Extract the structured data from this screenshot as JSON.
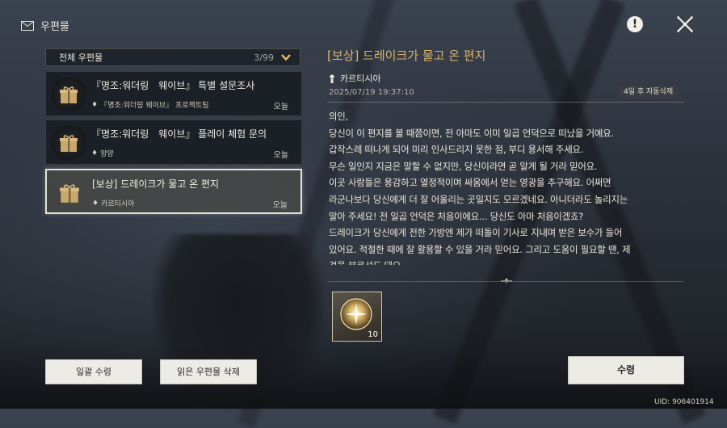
{
  "header": {
    "title": "우편물",
    "mail_icon": "mail-icon",
    "alert_icon": "exclamation-icon",
    "close_icon": "close-icon"
  },
  "list": {
    "header_label": "전체 우편물",
    "count": "3/99",
    "items": [
      {
        "title": "『명조:워더링　웨이브』 특별 설문조사",
        "sender": "『명조:워더링 웨이브』 프로젝트팀",
        "time": "오늘",
        "selected": false
      },
      {
        "title": "『명조:워더링　웨이브』 플레이 체험 문의",
        "sender": "양양",
        "time": "오늘",
        "selected": false
      },
      {
        "title": "[보상] 드레이크가 물고 온 편지",
        "sender": "카르티시아",
        "time": "오늘",
        "selected": true
      }
    ]
  },
  "detail": {
    "title": "[보상] 드레이크가 물고 온 편지",
    "sender": "카르티시아",
    "date": "2025/07/19 19:37:10",
    "expire": "4일 후 자동삭제",
    "body": [
      "의인,",
      "당신이 이 편지를 볼 때쯤이면, 전 아마도 이미 일곱 언덕으로 떠났을 거예요.",
      "갑작스레 떠나게 되어 미리 인사드리지 못한 점, 부디 용서해 주세요.",
      "무슨 일인지 지금은 말할 수 없지만, 당신이라면 곧 알게 될 거라 믿어요.",
      "이곳 사람들은 용감하고 열정적이며 싸움에서 얻는 영광을 추구해요. 어쩌면",
      "라군나보다 당신에게 더 잘 어울리는 곳일지도 모르겠네요. 아니더라도 놀리지는",
      "말아 주세요! 전 일곱 언덕은 처음이에요... 당신도 아마 처음이겠죠?",
      "드레이크가 당신에게 전한 가방엔 제가 떠돌이 기사로 지내며 받은 보수가 들어",
      "있어요. 적절한 때에 잘 활용할 수 있을 거라 믿어요. 그리고 도움이 필요할 땐, 제",
      "걱을 부르셔도 돼요"
    ],
    "reward": {
      "icon": "coin-orb-icon",
      "quantity": "10"
    }
  },
  "buttons": {
    "claim_all": "일괄 수령",
    "delete_read": "읽은 우편물 삭제",
    "receive": "수령"
  },
  "uid": "UID: 906401914",
  "colors": {
    "accent_gold": "#d9b46a",
    "button_bg": "#ecebe6"
  }
}
